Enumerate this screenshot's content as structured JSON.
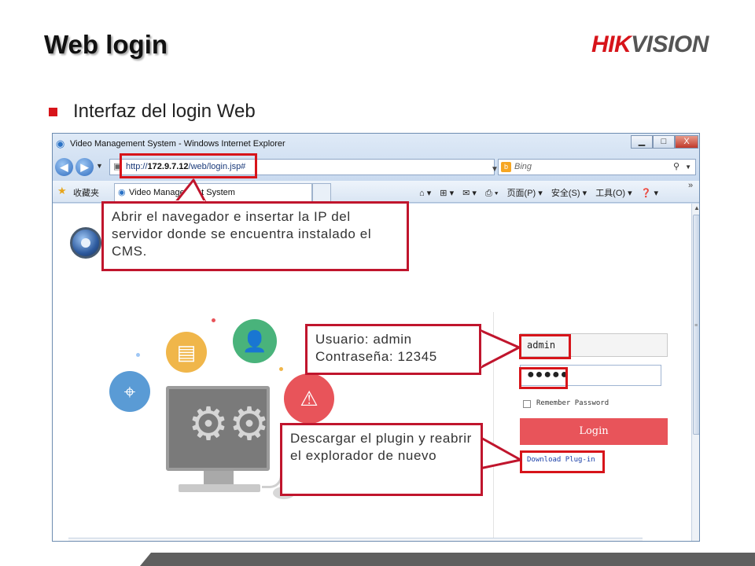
{
  "slide": {
    "title": "Web login",
    "brand": {
      "prefix": "HIK",
      "suffix": "VISION"
    },
    "bullet": "Interfaz del login Web"
  },
  "browser": {
    "window_title": "Video Management System - Windows Internet Explorer",
    "controls": {
      "minimize": "▁",
      "maximize": "□",
      "close": "X"
    },
    "address": {
      "scheme": "http://",
      "host": "172.9.7.12",
      "path": "/web/login.jsp#"
    },
    "search_placeholder": "Bing",
    "favorites_label": "收藏夹",
    "tab_title": "Video Management System",
    "commands": {
      "page": "页面(P) ▾",
      "safety": "安全(S) ▾",
      "tools": "工具(O) ▾",
      "help": "❓ ▾"
    }
  },
  "login": {
    "username_value": "admin",
    "password_mask": "●●●●●",
    "remember_label": "Remember Password",
    "login_button": "Login",
    "plugin_link": "Download Plug-in"
  },
  "callouts": {
    "browser": "Abrir el navegador e insertar la IP del servidor donde se encuentra instalado el CMS.",
    "creds_user": "Usuario: admin",
    "creds_pass": "Contraseña: 12345",
    "plugin": "Descargar el plugin y reabrir el explorador de nuevo"
  },
  "colors": {
    "accent": "#d7141a",
    "login_button": "#e8545a",
    "callout_border": "#c0152d"
  },
  "icons": [
    "back-arrow-icon",
    "forward-arrow-icon",
    "page-icon",
    "bing-icon",
    "search-icon",
    "favorites-star-icon",
    "home-icon",
    "camera-icon",
    "film-clock-icon",
    "user-gear-icon",
    "alarm-icon",
    "gears-icon"
  ]
}
